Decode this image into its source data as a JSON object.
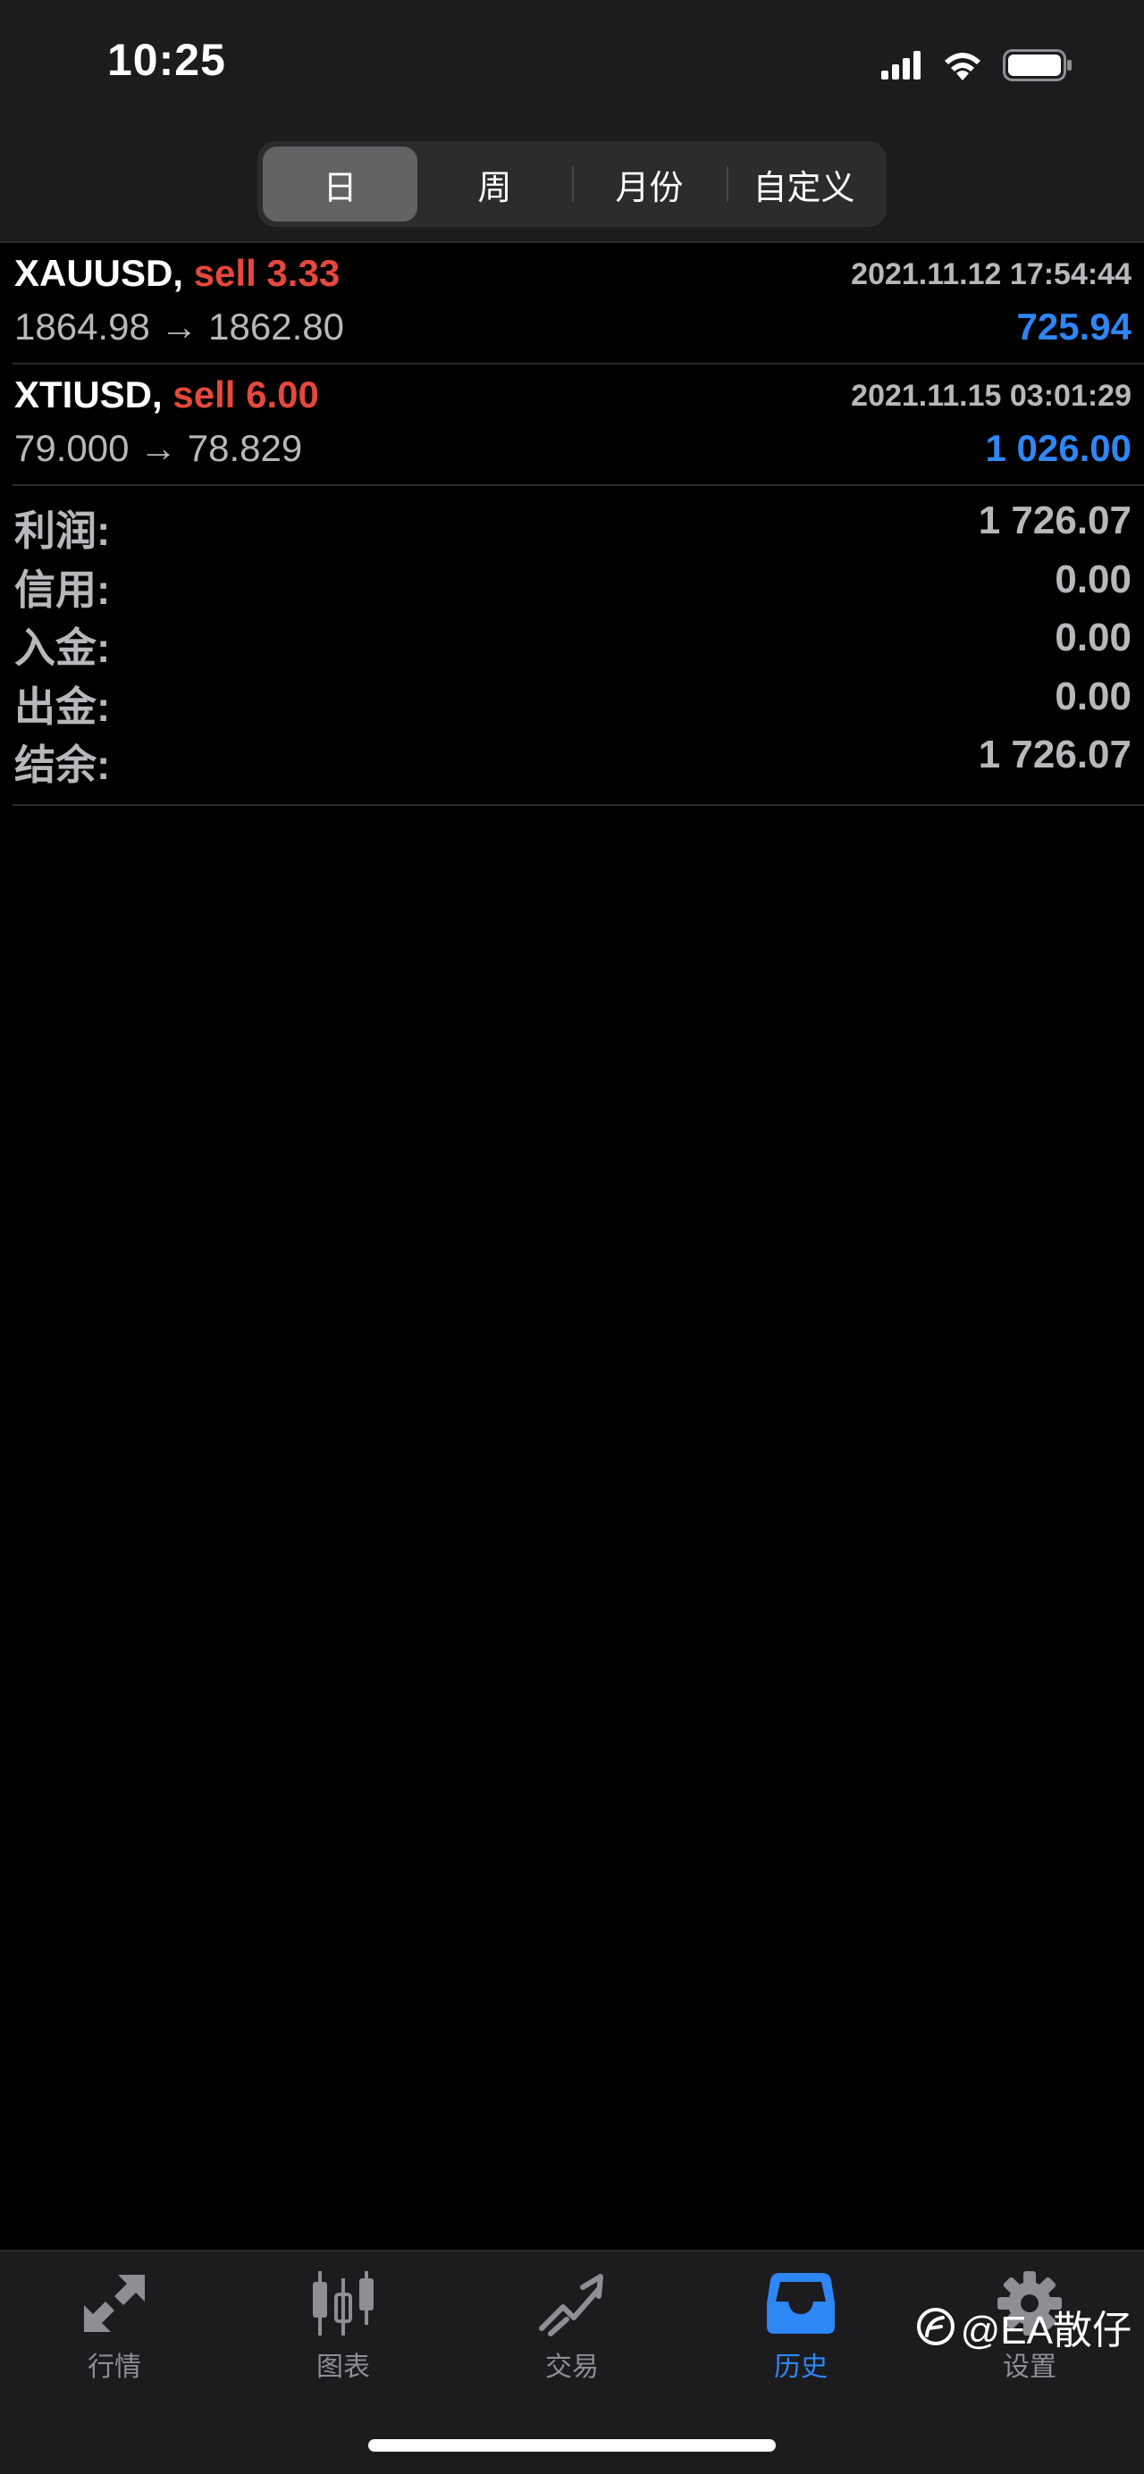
{
  "status_bar": {
    "time": "10:25",
    "icons": [
      "signal-icon",
      "wifi-icon",
      "battery-icon"
    ]
  },
  "period_tabs": [
    {
      "label": "日",
      "active": true
    },
    {
      "label": "周",
      "active": false
    },
    {
      "label": "月份",
      "active": false
    },
    {
      "label": "自定义",
      "active": false
    }
  ],
  "deals": [
    {
      "symbol": "XAUUSD,",
      "side": "sell 3.33",
      "time": "2021.11.12 17:54:44",
      "prices": "1864.98 → 1862.80",
      "profit": "725.94"
    },
    {
      "symbol": "XTIUSD,",
      "side": "sell 6.00",
      "time": "2021.11.15 03:01:29",
      "prices": "79.000 → 78.829",
      "profit": "1 026.00"
    }
  ],
  "summary": [
    {
      "label": "利润:",
      "value": "1 726.07"
    },
    {
      "label": "信用:",
      "value": "0.00"
    },
    {
      "label": "入金:",
      "value": "0.00"
    },
    {
      "label": "出金:",
      "value": "0.00"
    },
    {
      "label": "结余:",
      "value": "1 726.07"
    }
  ],
  "tab_bar": [
    {
      "label": "行情",
      "icon": "quotes-icon",
      "active": false
    },
    {
      "label": "图表",
      "icon": "chart-icon",
      "active": false
    },
    {
      "label": "交易",
      "icon": "trade-icon",
      "active": false
    },
    {
      "label": "历史",
      "icon": "history-icon",
      "active": true
    },
    {
      "label": "设置",
      "icon": "settings-icon",
      "active": false
    }
  ],
  "watermark": "@EA散仔",
  "colors": {
    "sell": "#e5483e",
    "profit": "#2f86f5",
    "active_tab": "#2f86f5",
    "inactive_tab": "#8e8e93"
  }
}
